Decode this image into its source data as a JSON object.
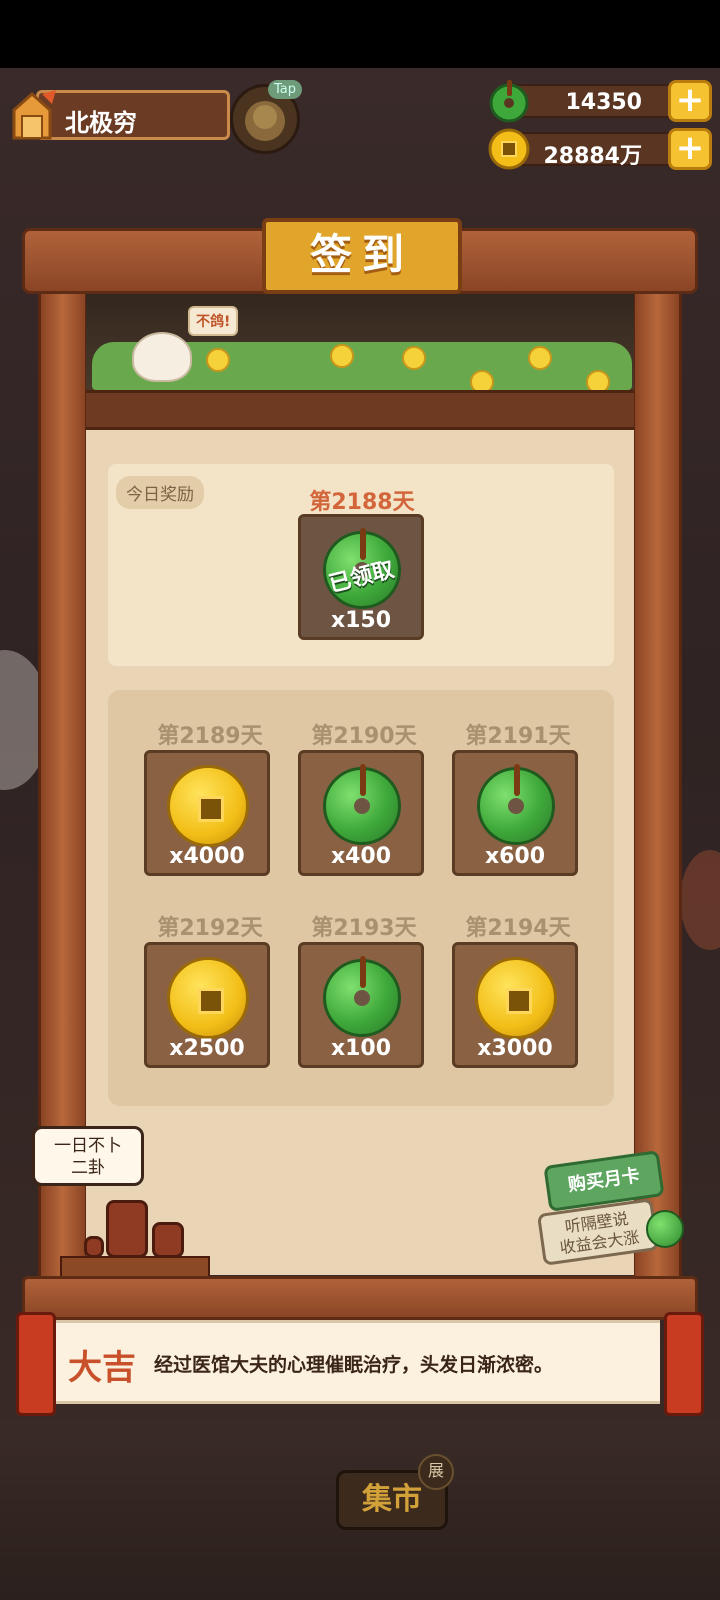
{
  "player": {
    "name": "北极穷"
  },
  "tap_button": {
    "label": "Tap"
  },
  "resources": [
    {
      "name": "jade",
      "value": "14350",
      "icon": "jade-icon"
    },
    {
      "name": "coin",
      "value": "28884万",
      "icon": "coin-icon"
    }
  ],
  "plus_label": "+",
  "board": {
    "title": "签到",
    "scene_bubble": "不鸽!"
  },
  "today": {
    "tag": "今日奖励",
    "day_label": "第2188天",
    "reward_icon": "jade-icon",
    "qty": "x150",
    "status": "已领取"
  },
  "upcoming": [
    {
      "day_label": "第2189天",
      "reward_icon": "coin-icon",
      "qty": "x4000"
    },
    {
      "day_label": "第2190天",
      "reward_icon": "jade-icon",
      "qty": "x400"
    },
    {
      "day_label": "第2191天",
      "reward_icon": "jade-icon",
      "qty": "x600"
    },
    {
      "day_label": "第2192天",
      "reward_icon": "coin-icon",
      "qty": "x2500"
    },
    {
      "day_label": "第2193天",
      "reward_icon": "jade-icon",
      "qty": "x100"
    },
    {
      "day_label": "第2194天",
      "reward_icon": "coin-icon",
      "qty": "x3000"
    }
  ],
  "ad_bubble": {
    "line1": "一日不卜",
    "line2": "二卦"
  },
  "month_card": {
    "title": "购买月卡",
    "line1": "听隔壁说",
    "line2": "收益会大涨"
  },
  "fortune": {
    "tag": "大吉",
    "text": "经过医馆大夫的心理催眠治疗，头发日渐浓密。"
  },
  "market": {
    "label": "集市",
    "badge": "展"
  },
  "colors": {
    "accent_gold": "#e0a52a",
    "jade_green": "#3ea83a",
    "today_red": "#d3653b"
  }
}
